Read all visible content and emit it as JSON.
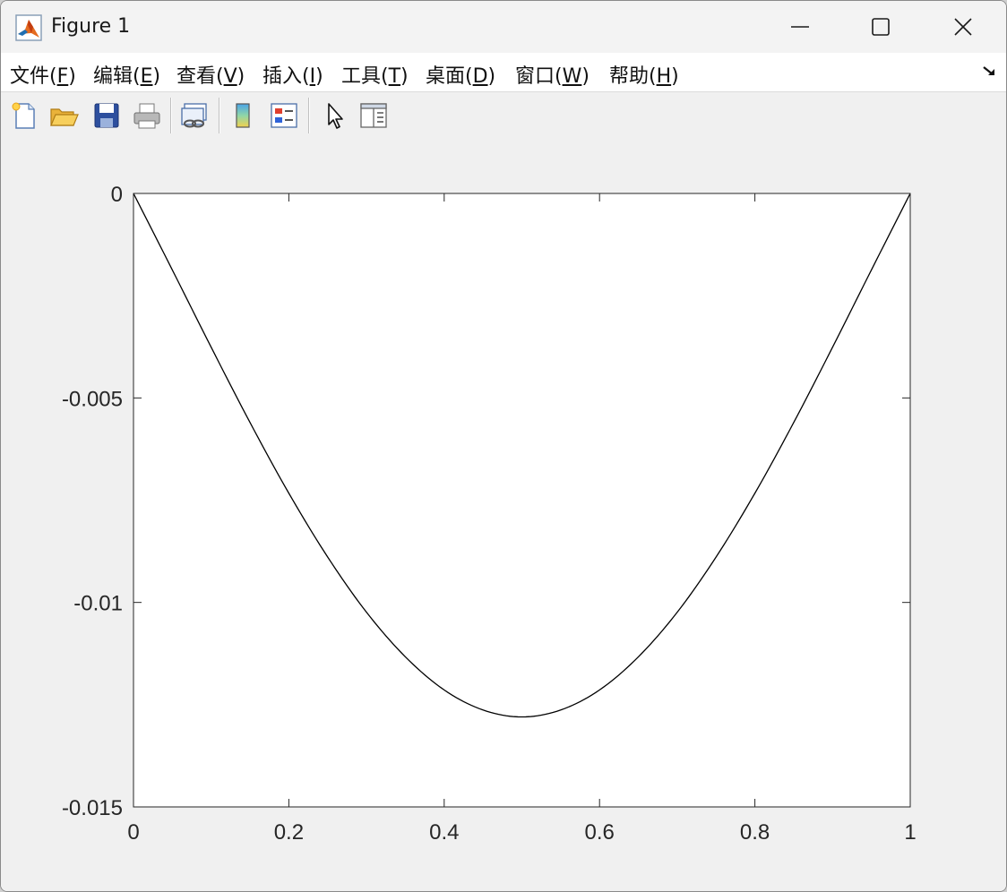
{
  "window": {
    "title": "Figure 1",
    "app_icon": "matlab-logo-icon",
    "controls": [
      "minimize-icon",
      "maximize-icon",
      "close-icon"
    ]
  },
  "menubar": {
    "items": [
      {
        "label": "文件(",
        "key": "F",
        "tail": ")"
      },
      {
        "label": "编辑(",
        "key": "E",
        "tail": ")"
      },
      {
        "label": "查看(",
        "key": "V",
        "tail": ")"
      },
      {
        "label": "插入(",
        "key": "I",
        "tail": ")"
      },
      {
        "label": "工具(",
        "key": "T",
        "tail": ")"
      },
      {
        "label": "桌面(",
        "key": "D",
        "tail": ")"
      },
      {
        "label": "窗口(",
        "key": "W",
        "tail": ")"
      },
      {
        "label": "帮助(",
        "key": "H",
        "tail": ")"
      }
    ]
  },
  "toolbar": {
    "buttons": [
      "new-figure-icon",
      "open-file-icon",
      "save-icon",
      "print-icon",
      "link-plot-icon",
      "insert-colorbar-icon",
      "insert-legend-icon",
      "edit-plot-pointer-icon",
      "property-inspector-icon"
    ]
  },
  "chart_data": {
    "type": "line",
    "title": "",
    "xlabel": "",
    "ylabel": "",
    "xlim": [
      0,
      1
    ],
    "ylim": [
      -0.015,
      0
    ],
    "xticks": [
      0,
      0.2,
      0.4,
      0.6,
      0.8,
      1
    ],
    "xtick_labels": [
      "0",
      "0.2",
      "0.4",
      "0.6",
      "0.8",
      "1"
    ],
    "yticks": [
      0,
      -0.005,
      -0.01,
      -0.015
    ],
    "ytick_labels": [
      "0",
      "-0.005",
      "-0.01",
      "-0.015"
    ],
    "grid": false,
    "legend": false,
    "series": [
      {
        "color": "#000000",
        "x": [
          0,
          0.05,
          0.1,
          0.15,
          0.2,
          0.25,
          0.3,
          0.35,
          0.4,
          0.45,
          0.5,
          0.55,
          0.6,
          0.65,
          0.7,
          0.75,
          0.8,
          0.85,
          0.9,
          0.95,
          1
        ],
        "y": [
          0,
          -0.00187,
          -0.00376,
          -0.0056,
          -0.00733,
          -0.00889,
          -0.01024,
          -0.01133,
          -0.01214,
          -0.01263,
          -0.0128,
          -0.01263,
          -0.01214,
          -0.01133,
          -0.01024,
          -0.00889,
          -0.00733,
          -0.0056,
          -0.00376,
          -0.00187,
          0
        ]
      }
    ]
  }
}
